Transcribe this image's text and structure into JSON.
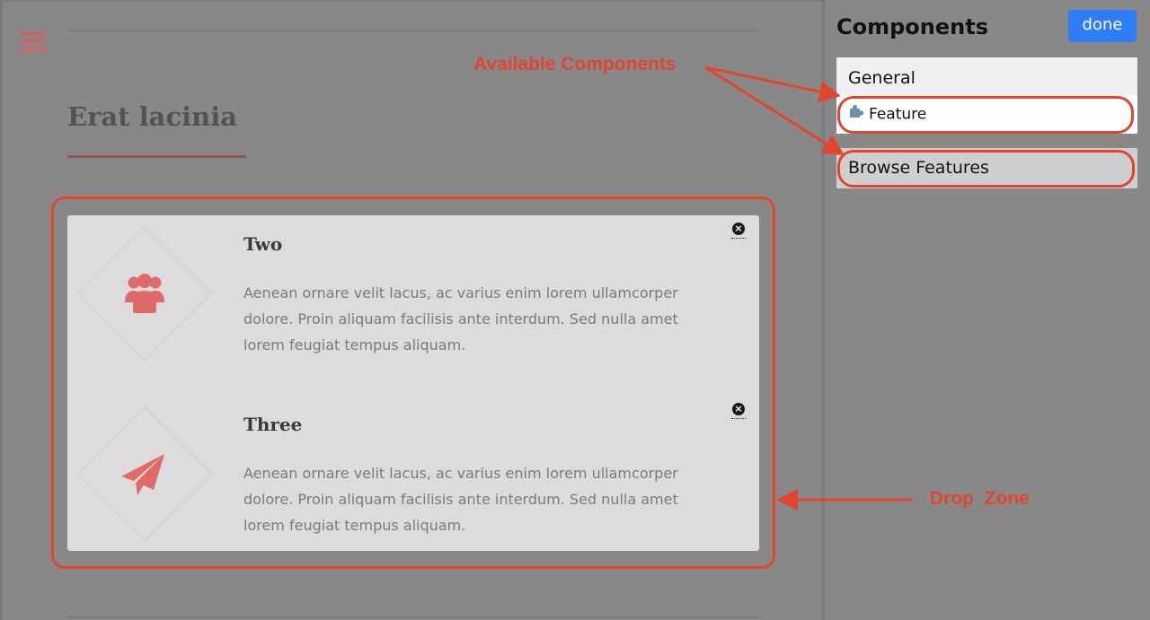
{
  "colors": {
    "accent": "#d06262",
    "annotation": "#e0462f",
    "done_button": "#2f7df6",
    "overlay": "#888888"
  },
  "page": {
    "menu_icon": "hamburger-menu-icon",
    "section_title": "Erat lacinia",
    "features": [
      {
        "title": "Two",
        "icon": "users-group-icon",
        "description": "Aenean ornare velit lacus, ac varius enim lorem ullamcorper dolore. Proin aliquam facilisis ante interdum. Sed nulla amet lorem feugiat tempus aliquam.",
        "remove_icon": "close-circle-icon"
      },
      {
        "title": "Three",
        "icon": "paper-plane-icon",
        "description": "Aenean ornare velit lacus, ac varius enim lorem ullamcorper dolore. Proin aliquam facilisis ante interdum. Sed nulla amet lorem feugiat tempus aliquam.",
        "remove_icon": "close-circle-icon"
      }
    ]
  },
  "panel": {
    "title": "Components",
    "done_label": "done",
    "groups": [
      {
        "header": "General",
        "items": [
          {
            "label": "Feature",
            "icon": "puzzle-piece-icon"
          }
        ]
      }
    ],
    "browse_label": "Browse Features"
  },
  "annotations": {
    "available_components": "Available Components",
    "drop_zone": "Drop  Zone"
  }
}
